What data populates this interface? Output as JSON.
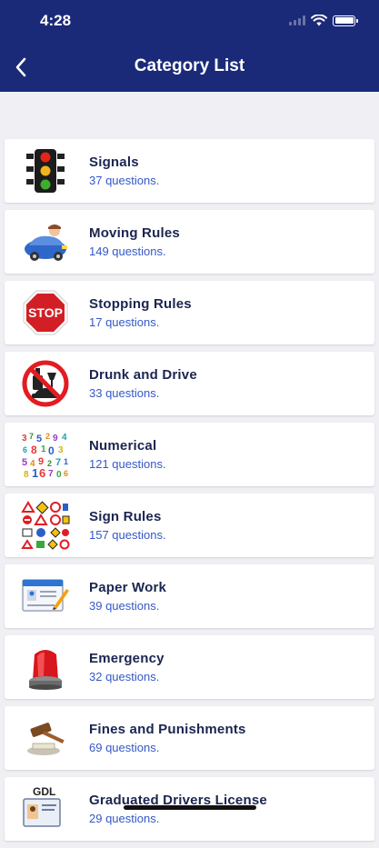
{
  "status_bar": {
    "time": "4:28"
  },
  "header": {
    "title": "Category List"
  },
  "categories": [
    {
      "name": "Signals",
      "count": "37 questions.",
      "icon": "traffic-light-icon"
    },
    {
      "name": "Moving Rules",
      "count": "149 questions.",
      "icon": "car-driver-icon"
    },
    {
      "name": "Stopping Rules",
      "count": "17 questions.",
      "icon": "stop-sign-icon"
    },
    {
      "name": "Drunk and Drive",
      "count": "33 questions.",
      "icon": "no-drunk-driving-icon"
    },
    {
      "name": "Numerical",
      "count": "121 questions.",
      "icon": "numbers-icon"
    },
    {
      "name": "Sign Rules",
      "count": "157 questions.",
      "icon": "road-signs-icon"
    },
    {
      "name": "Paper Work",
      "count": "39 questions.",
      "icon": "document-pencil-icon"
    },
    {
      "name": "Emergency",
      "count": "32 questions.",
      "icon": "siren-icon"
    },
    {
      "name": "Fines and Punishments",
      "count": "69 questions.",
      "icon": "gavel-icon"
    },
    {
      "name": "Graduated Drivers License",
      "count": "29 questions.",
      "icon": "drivers-license-icon",
      "icon_text": "GDL"
    }
  ],
  "colors": {
    "header": "#1a2a78",
    "category_name": "#1b2550",
    "question_count": "#3558c8",
    "background": "#f0f0f4"
  }
}
